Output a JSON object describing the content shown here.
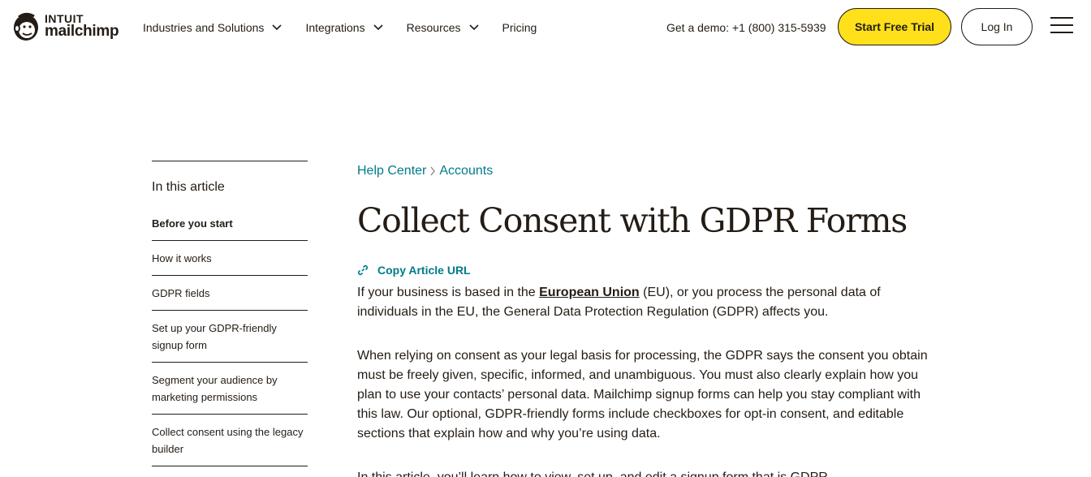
{
  "header": {
    "logo_top": "INTUIT",
    "logo_bottom": "mailchimp",
    "nav": [
      {
        "label": "Industries and Solutions",
        "has_dropdown": true
      },
      {
        "label": "Integrations",
        "has_dropdown": true
      },
      {
        "label": "Resources",
        "has_dropdown": true
      },
      {
        "label": "Pricing",
        "has_dropdown": false
      }
    ],
    "demo_text": "Get a demo: +1 (800) 315-5939",
    "trial_button": "Start Free Trial",
    "login_button": "Log In",
    "menu_icon": "hamburger-menu-icon"
  },
  "sidebar": {
    "heading": "In this article",
    "items": [
      {
        "label": "Before you start",
        "active": true
      },
      {
        "label": "How it works",
        "active": false
      },
      {
        "label": "GDPR fields",
        "active": false
      },
      {
        "label": "Set up your GDPR-friendly signup form",
        "active": false
      },
      {
        "label": "Segment your audience by marketing permissions",
        "active": false
      },
      {
        "label": "Collect consent using the legacy builder",
        "active": false
      }
    ]
  },
  "main": {
    "breadcrumb": [
      "Help Center",
      "Accounts"
    ],
    "title": "Collect Consent with GDPR Forms",
    "copy_url_label": "Copy Article URL",
    "p1_before": "If your business is based in the ",
    "p1_link": "European Union",
    "p1_after": " (EU), or you process the personal data of individuals in the EU, the General Data Protection Regulation (GDPR) affects you.",
    "p2": "When relying on consent as your legal basis for processing, the GDPR says the consent you obtain must be freely given, specific, informed, and unambiguous. You must also clearly explain how you plan to use your contacts’ personal data. Mailchimp signup forms can help you stay compliant with this law. Our optional, GDPR-friendly forms include checkboxes for opt-in consent, and editable sections that explain how and why you’re using data.",
    "p3": "In this article, you’ll learn how to view, set up, and edit a signup form that is GDPR"
  },
  "colors": {
    "accent_yellow": "#ffe01b",
    "link_teal": "#007c89",
    "text": "#241c15"
  }
}
